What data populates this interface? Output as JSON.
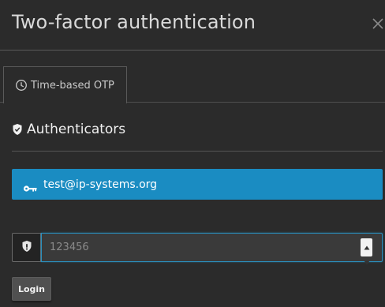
{
  "dialog": {
    "title": "Two-factor authentication",
    "close_icon": "close-icon"
  },
  "tabs": [
    {
      "label": "Time-based OTP",
      "icon": "clock-icon",
      "active": true
    }
  ],
  "authenticators": {
    "heading": "Authenticators",
    "heading_icon": "shield-icon",
    "items": [
      {
        "label": "test@ip-systems.org",
        "icon": "key-icon",
        "selected": true
      }
    ],
    "accent_color": "#1a8cc2"
  },
  "otp": {
    "addon_icon": "shield-icon",
    "value": "",
    "placeholder": "123456"
  },
  "actions": {
    "login_label": "Login"
  }
}
